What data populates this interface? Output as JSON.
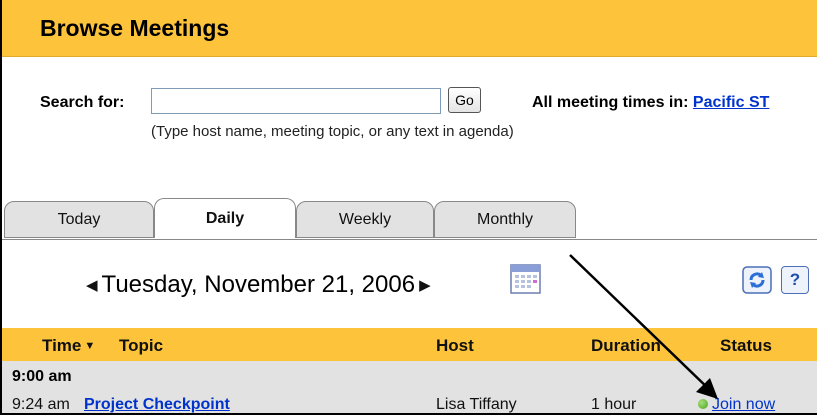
{
  "header": {
    "title": "Browse Meetings"
  },
  "search": {
    "label": "Search for:",
    "value": "",
    "placeholder": "",
    "go_label": "Go",
    "hint": "(Type host name, meeting topic, or any text in agenda)"
  },
  "timezone": {
    "label": "All meeting times in:",
    "link": "Pacific ST"
  },
  "tabs": [
    {
      "label": "Today"
    },
    {
      "label": "Daily"
    },
    {
      "label": "Weekly"
    },
    {
      "label": "Monthly"
    }
  ],
  "active_tab": "Daily",
  "date_nav": {
    "prev_arrow": "◀",
    "date": "Tuesday, November 21, 2006",
    "next_arrow": "▶"
  },
  "icons": {
    "calendar": "calendar-icon",
    "refresh": "refresh-icon",
    "help": "help-icon"
  },
  "help_glyph": "?",
  "table": {
    "columns": {
      "time": "Time",
      "topic": "Topic",
      "host": "Host",
      "duration": "Duration",
      "status": "Status"
    },
    "hour_label": "9:00 am",
    "rows": [
      {
        "time": "9:24 am",
        "topic": "Project Checkpoint",
        "host": "Lisa Tiffany",
        "duration": "1 hour",
        "status": "Join now"
      }
    ]
  },
  "colors": {
    "accent": "#fdc43b",
    "link": "#0033cc",
    "row_bg": "#e2e2e2",
    "status_dot": "#4aa21e"
  }
}
